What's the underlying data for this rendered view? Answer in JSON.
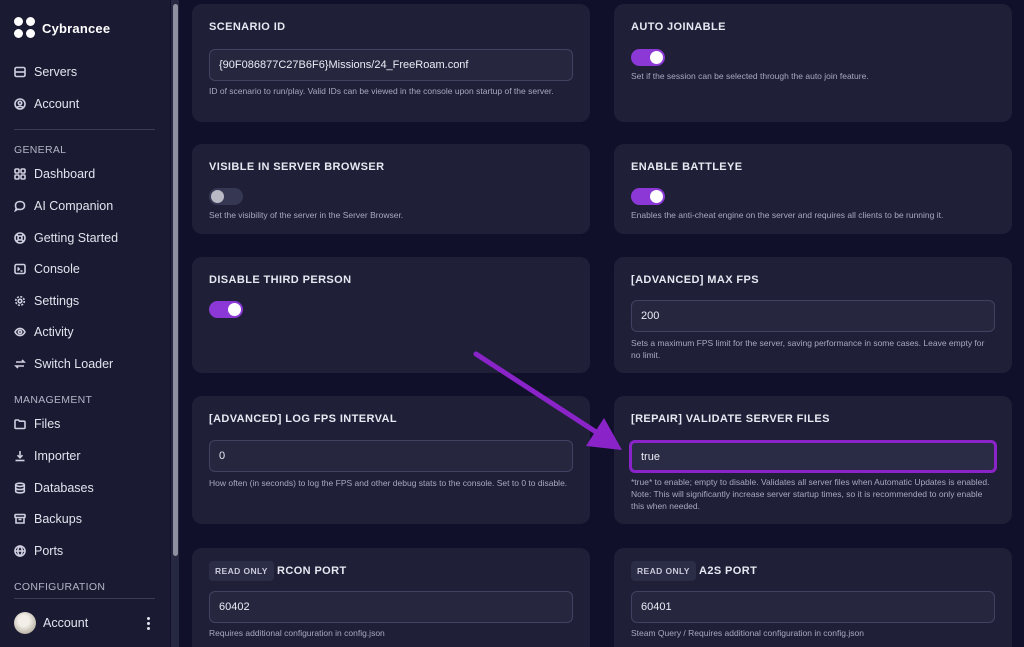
{
  "brand": {
    "name": "Cybrancee"
  },
  "nav_top": [
    {
      "label": "Servers",
      "icon": "server-icon"
    },
    {
      "label": "Account",
      "icon": "user-circle-icon"
    }
  ],
  "sections": {
    "general": "GENERAL",
    "management": "MANAGEMENT",
    "configuration": "CONFIGURATION"
  },
  "nav_general": [
    {
      "label": "Dashboard",
      "icon": "grid-icon"
    },
    {
      "label": "AI Companion",
      "icon": "chat-icon"
    },
    {
      "label": "Getting Started",
      "icon": "lifebuoy-icon"
    },
    {
      "label": "Console",
      "icon": "terminal-icon"
    },
    {
      "label": "Settings",
      "icon": "gear-icon"
    },
    {
      "label": "Activity",
      "icon": "eye-icon"
    },
    {
      "label": "Switch Loader",
      "icon": "swap-icon"
    }
  ],
  "nav_management": [
    {
      "label": "Files",
      "icon": "folder-icon"
    },
    {
      "label": "Importer",
      "icon": "download-icon"
    },
    {
      "label": "Databases",
      "icon": "database-icon"
    },
    {
      "label": "Backups",
      "icon": "archive-icon"
    },
    {
      "label": "Ports",
      "icon": "globe-icon"
    }
  ],
  "account_footer": {
    "label": "Account"
  },
  "cards": {
    "scenario_id": {
      "title": "SCENARIO ID",
      "value": "{90F086877C27B6F6}Missions/24_FreeRoam.conf",
      "desc": "ID of scenario to run/play. Valid IDs can be viewed in the console upon startup of the server."
    },
    "auto_joinable": {
      "title": "AUTO JOINABLE",
      "state": "on",
      "desc": "Set if the session can be selected through the auto join feature."
    },
    "visible_browser": {
      "title": "VISIBLE IN SERVER BROWSER",
      "state": "off",
      "desc": "Set the visibility of the server in the Server Browser."
    },
    "battleye": {
      "title": "ENABLE BATTLEYE",
      "state": "on",
      "desc": "Enables the anti-cheat engine on the server and requires all clients to be running it."
    },
    "third_person": {
      "title": "DISABLE THIRD PERSON",
      "state": "on"
    },
    "max_fps": {
      "title": "[ADVANCED] MAX FPS",
      "value": "200",
      "desc": "Sets a maximum FPS limit for the server, saving performance in some cases. Leave empty for no limit."
    },
    "log_fps": {
      "title": "[ADVANCED] LOG FPS INTERVAL",
      "value": "0",
      "desc": "How often (in seconds) to log the FPS and other debug stats to the console. Set to 0 to disable."
    },
    "validate": {
      "title": "[REPAIR] VALIDATE SERVER FILES",
      "value": "true",
      "desc": "*true* to enable; empty to disable. Validates all server files when Automatic Updates is enabled. Note: This will significantly increase server startup times, so it is recommended to only enable this when needed."
    },
    "rcon": {
      "badge": "READ ONLY",
      "title": "RCON PORT",
      "value": "60402",
      "desc": "Requires additional configuration in config.json"
    },
    "a2s": {
      "badge": "READ ONLY",
      "title": "A2S PORT",
      "value": "60401",
      "desc": "Steam Query / Requires additional configuration in config.json"
    }
  },
  "colors": {
    "accent": "#8b38d6",
    "annotation_arrow": "#8a24c9",
    "background": "#10102a",
    "card": "#1f2038"
  }
}
